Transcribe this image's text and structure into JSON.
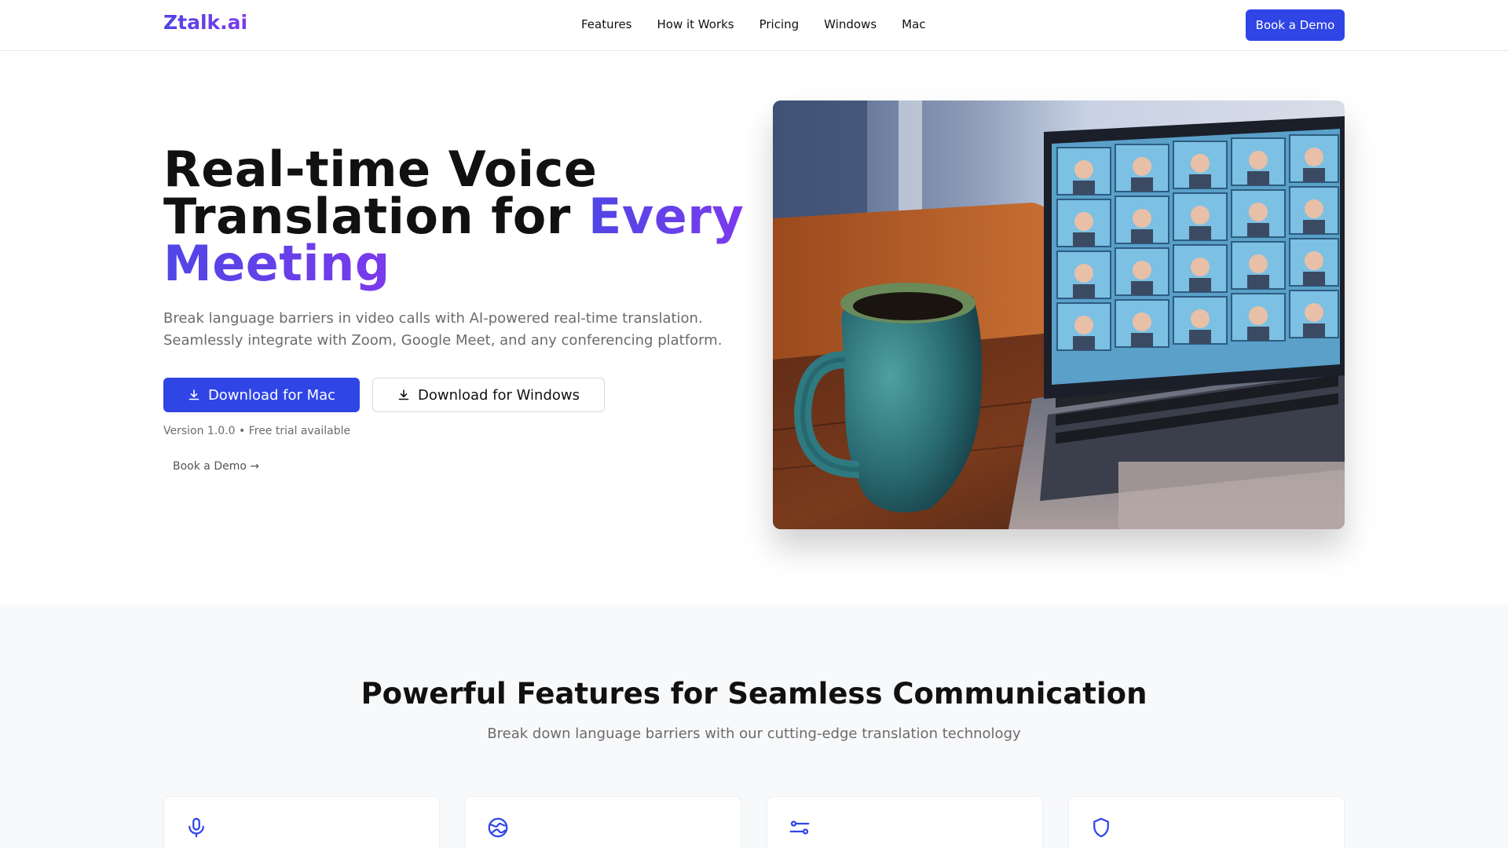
{
  "nav": {
    "logo": "Ztalk.ai",
    "links": [
      "Features",
      "How it Works",
      "Pricing",
      "Windows",
      "Mac"
    ],
    "cta": "Book a Demo"
  },
  "hero": {
    "title_line1": "Real-time Voice",
    "title_line2_plain": "Translation for ",
    "title_line2_accent": "Every",
    "title_line3_accent": "Meeting",
    "subtitle_line1": "Break language barriers in video calls with AI-powered real-time translation.",
    "subtitle_line2": "Seamlessly integrate with Zoom, Google Meet, and any conferencing platform.",
    "download_mac": "Download for Mac",
    "download_windows": "Download for Windows",
    "version_note": "Version 1.0.0 • Free trial available",
    "demo_link": "Book a Demo →"
  },
  "features": {
    "title": "Powerful Features for Seamless Communication",
    "subtitle": "Break down language barriers with our cutting-edge translation technology",
    "cards": [
      {
        "icon": "microphone-icon"
      },
      {
        "icon": "globe-icon"
      },
      {
        "icon": "sliders-icon"
      },
      {
        "icon": "shield-icon"
      }
    ]
  },
  "colors": {
    "primary": "#2f45e6",
    "accent_start": "#4f46e5",
    "accent_end": "#7c3aed"
  }
}
